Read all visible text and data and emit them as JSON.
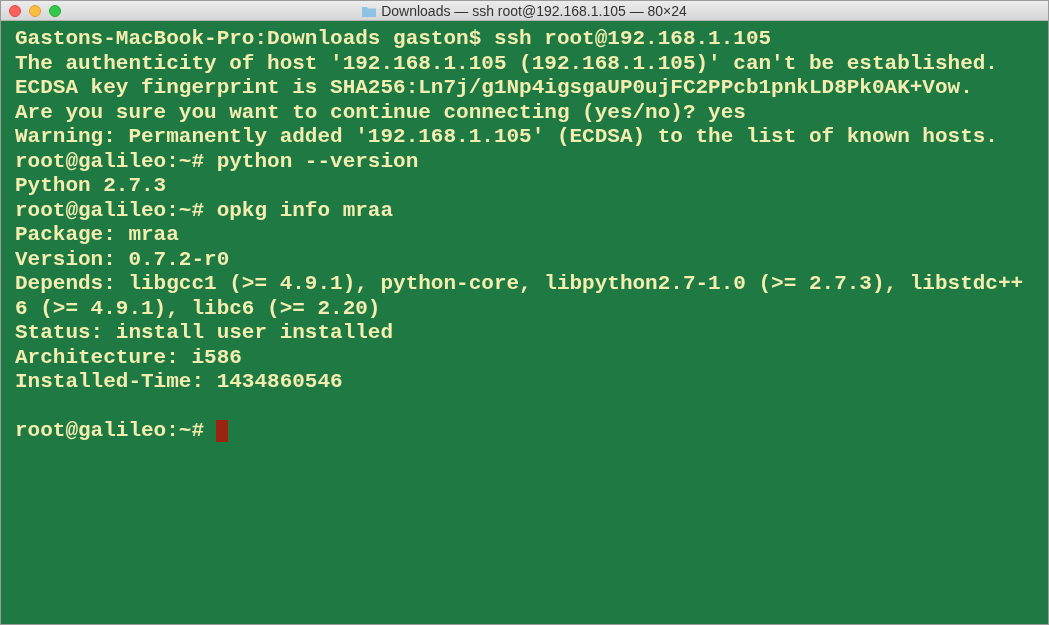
{
  "window": {
    "title": "Downloads — ssh root@192.168.1.105 — 80×24"
  },
  "terminal": {
    "lines": [
      {
        "kind": "text",
        "text": "Gastons-MacBook-Pro:Downloads gaston$ ssh root@192.168.1.105"
      },
      {
        "kind": "text",
        "text": "The authenticity of host '192.168.1.105 (192.168.1.105)' can't be established."
      },
      {
        "kind": "text",
        "text": "ECDSA key fingerprint is SHA256:Ln7j/g1Np4igsgaUP0ujFC2PPcb1pnkLD8Pk0AK+Vow."
      },
      {
        "kind": "text",
        "text": "Are you sure you want to continue connecting (yes/no)? yes"
      },
      {
        "kind": "text",
        "text": "Warning: Permanently added '192.168.1.105' (ECDSA) to the list of known hosts."
      },
      {
        "kind": "text",
        "text": "root@galileo:~# python --version"
      },
      {
        "kind": "text",
        "text": "Python 2.7.3"
      },
      {
        "kind": "text",
        "text": "root@galileo:~# opkg info mraa"
      },
      {
        "kind": "text",
        "text": "Package: mraa"
      },
      {
        "kind": "text",
        "text": "Version: 0.7.2-r0"
      },
      {
        "kind": "text",
        "text": "Depends: libgcc1 (>= 4.9.1), python-core, libpython2.7-1.0 (>= 2.7.3), libstdc++"
      },
      {
        "kind": "text",
        "text": "6 (>= 4.9.1), libc6 (>= 2.20)"
      },
      {
        "kind": "text",
        "text": "Status: install user installed"
      },
      {
        "kind": "text",
        "text": "Architecture: i586"
      },
      {
        "kind": "text",
        "text": "Installed-Time: 1434860546"
      },
      {
        "kind": "blank"
      },
      {
        "kind": "prompt",
        "text": "root@galileo:~#",
        "cursor": true
      }
    ]
  }
}
